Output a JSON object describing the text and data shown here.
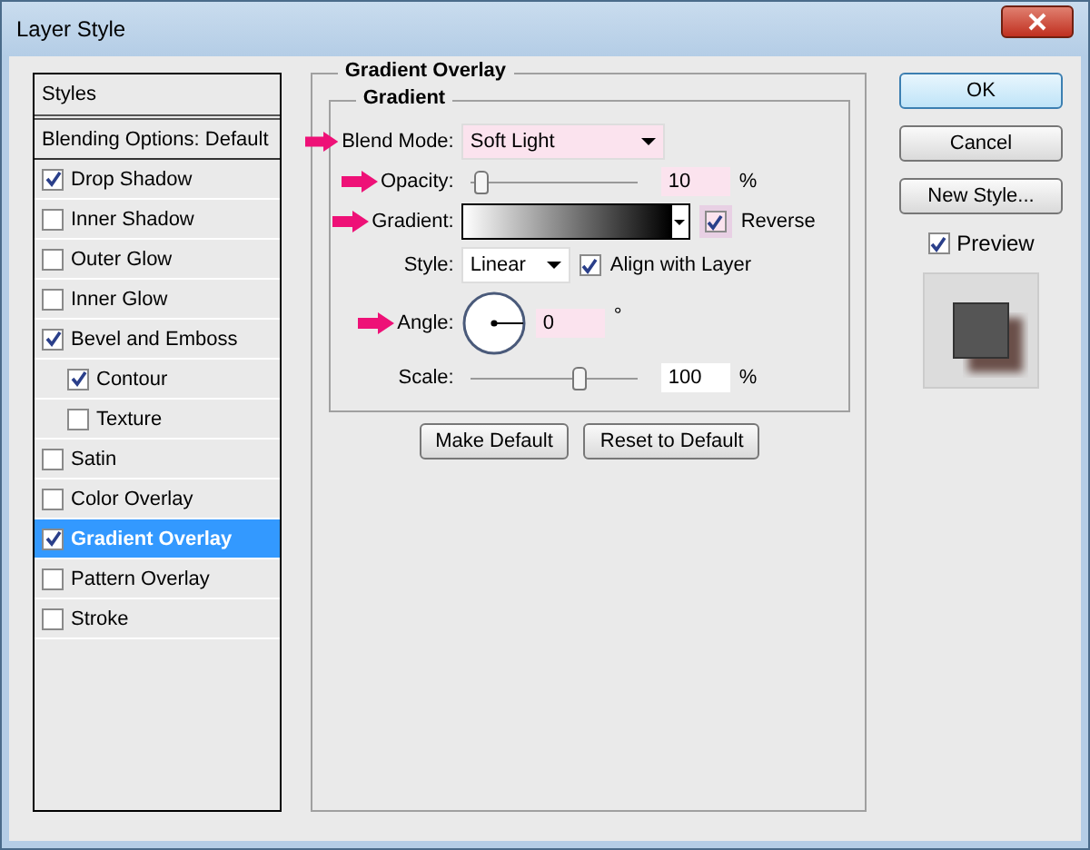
{
  "window": {
    "title": "Layer Style"
  },
  "styles_list": {
    "header": "Styles",
    "items": [
      {
        "kind": "plain",
        "label": "Blending Options: Default",
        "selected": false
      },
      {
        "kind": "check",
        "label": "Drop Shadow",
        "checked": true,
        "selected": false
      },
      {
        "kind": "check",
        "label": "Inner Shadow",
        "checked": false,
        "selected": false
      },
      {
        "kind": "check",
        "label": "Outer Glow",
        "checked": false,
        "selected": false
      },
      {
        "kind": "check",
        "label": "Inner Glow",
        "checked": false,
        "selected": false
      },
      {
        "kind": "check",
        "label": "Bevel and Emboss",
        "checked": true,
        "selected": false,
        "children": [
          {
            "kind": "check",
            "label": "Contour",
            "checked": true,
            "selected": false
          },
          {
            "kind": "check",
            "label": "Texture",
            "checked": false,
            "selected": false
          }
        ]
      },
      {
        "kind": "check",
        "label": "Satin",
        "checked": false,
        "selected": false
      },
      {
        "kind": "check",
        "label": "Color Overlay",
        "checked": false,
        "selected": false
      },
      {
        "kind": "check",
        "label": "Gradient Overlay",
        "checked": true,
        "selected": true
      },
      {
        "kind": "check",
        "label": "Pattern Overlay",
        "checked": false,
        "selected": false
      },
      {
        "kind": "check",
        "label": "Stroke",
        "checked": false,
        "selected": false
      }
    ]
  },
  "panel": {
    "title": "Gradient Overlay",
    "group_title": "Gradient",
    "blend_mode": {
      "label": "Blend Mode:",
      "value": "Soft Light",
      "highlighted": true,
      "marked": true
    },
    "opacity": {
      "label": "Opacity:",
      "level": 0.08,
      "value": "10",
      "unit": "%",
      "highlighted": true,
      "marked": true
    },
    "gradient": {
      "label": "Gradient:",
      "marked": true,
      "reverse": {
        "label": "Reverse",
        "checked": true,
        "highlighted": true
      }
    },
    "style": {
      "label": "Style:",
      "value": "Linear",
      "marked": false,
      "align": {
        "label": "Align with Layer",
        "checked": true
      }
    },
    "angle": {
      "label": "Angle:",
      "value": "0",
      "unit": "°",
      "highlighted": true,
      "marked": true
    },
    "scale": {
      "label": "Scale:",
      "level": 0.63,
      "value": "100",
      "unit": "%",
      "highlighted": false,
      "marked": false
    },
    "buttons": [
      "Make Default",
      "Reset to Default"
    ]
  },
  "side": {
    "buttons": [
      {
        "label": "OK",
        "default": true
      },
      {
        "label": "Cancel",
        "default": false
      },
      {
        "label": "New Style...",
        "default": false
      }
    ],
    "preview": {
      "label": "Preview",
      "checked": true
    }
  }
}
